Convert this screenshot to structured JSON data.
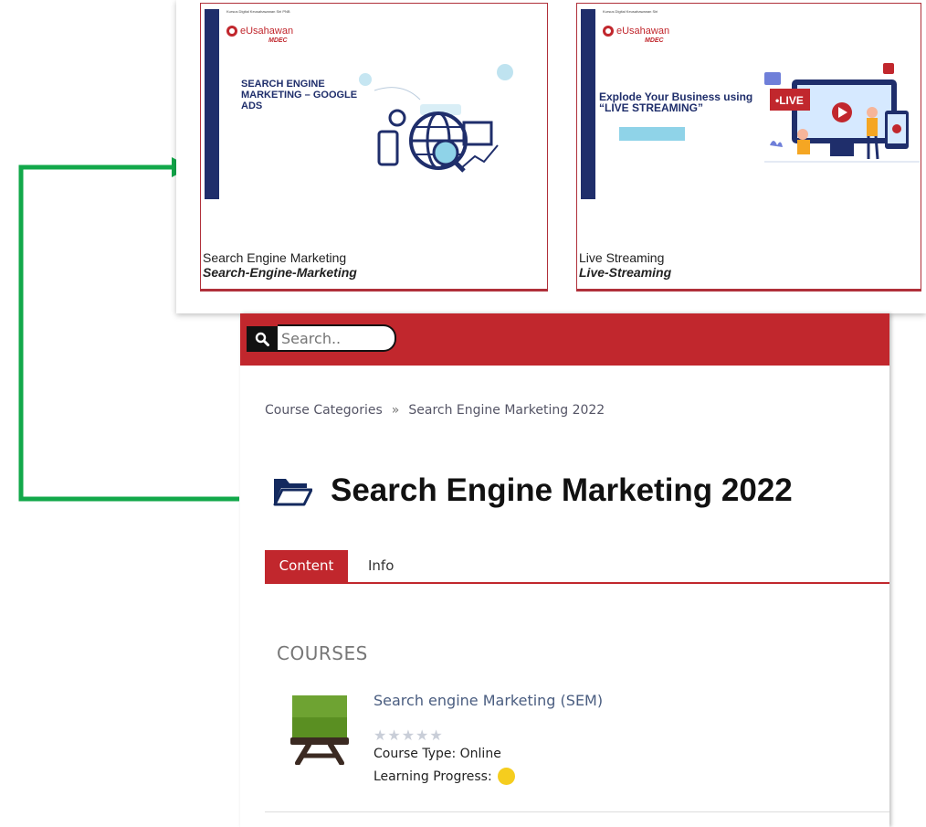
{
  "cards": [
    {
      "tiny_header": "Kursus Digital Keusahawanan Siri PNB",
      "brand_name": "eUsahawan",
      "brand_sub": "MDEC",
      "headline": "SEARCH ENGINE MARKETING – GOOGLE ADS",
      "title": "Search Engine Marketing",
      "alias": "Search-Engine-Marketing"
    },
    {
      "tiny_header": "Kursus Digital Keusahawanan Siri",
      "brand_name": "eUsahawan",
      "brand_sub": "MDEC",
      "headline": "Explode Your Business using “LIVE STREAMING”",
      "live_badge": "•LIVE",
      "title": "Live Streaming",
      "alias": "Live-Streaming"
    }
  ],
  "colors": {
    "accent_red": "#c1272d",
    "arrow_green": "#12a84a",
    "navy": "#1f2e6b"
  },
  "search": {
    "placeholder": "Search.."
  },
  "breadcrumb": {
    "root": "Course Categories",
    "separator": "»",
    "current": "Search Engine Marketing 2022"
  },
  "page_title": "Search Engine Marketing 2022",
  "title_icon": "folder-open-icon",
  "tabs": [
    {
      "label": "Content",
      "active": true
    },
    {
      "label": "Info",
      "active": false
    }
  ],
  "section_heading": "COURSES",
  "courses": [
    {
      "name": "Search engine Marketing (SEM)",
      "icon": "chalkboard-easel-icon",
      "rating": 0,
      "rating_max": 5,
      "course_type": "Course Type: Online",
      "progress_label": "Learning Progress:"
    }
  ]
}
